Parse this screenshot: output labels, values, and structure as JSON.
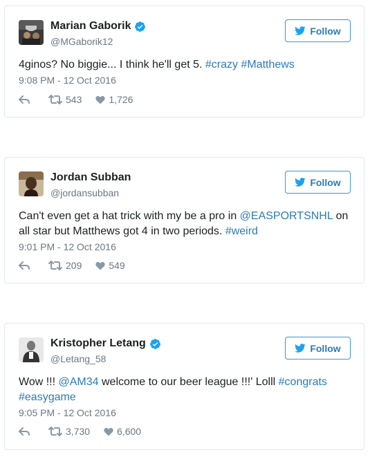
{
  "colors": {
    "link": "#2b7bb9",
    "meta": "#697882",
    "border": "#e1e8ed",
    "verified": "#1da1f2"
  },
  "follow_label": "Follow",
  "tweets": [
    {
      "name": "Marian Gaborik",
      "verified": true,
      "handle": "@MGaborik12",
      "text": {
        "plain": "4ginos? No biggie... I think he'll get 5. ",
        "tag1": "#crazy",
        "sep": " ",
        "tag2": "#Matthews"
      },
      "time": "9:08 PM - 12 Oct 2016",
      "retweets": "543",
      "likes": "1,726"
    },
    {
      "name": "Jordan Subban",
      "verified": false,
      "handle": "@jordansubban",
      "text": {
        "plain": "Can't even get a hat trick with my be a pro in ",
        "mention": "@EASPORTSNHL",
        "plain2": " on all star but Matthews got 4 in two periods. ",
        "tag1": "#weird"
      },
      "time": "9:01 PM - 12 Oct 2016",
      "retweets": "209",
      "likes": "549"
    },
    {
      "name": "Kristopher Letang",
      "verified": true,
      "handle": "@Letang_58",
      "text": {
        "plain": "Wow !!! ",
        "mention": "@AM34",
        "plain2": " welcome to our beer league !!!' Lolll ",
        "tag1": "#congrats",
        "sep": " ",
        "tag2": "#easygame"
      },
      "time": "9:05 PM - 12 Oct 2016",
      "retweets": "3,730",
      "likes": "6,600"
    }
  ]
}
